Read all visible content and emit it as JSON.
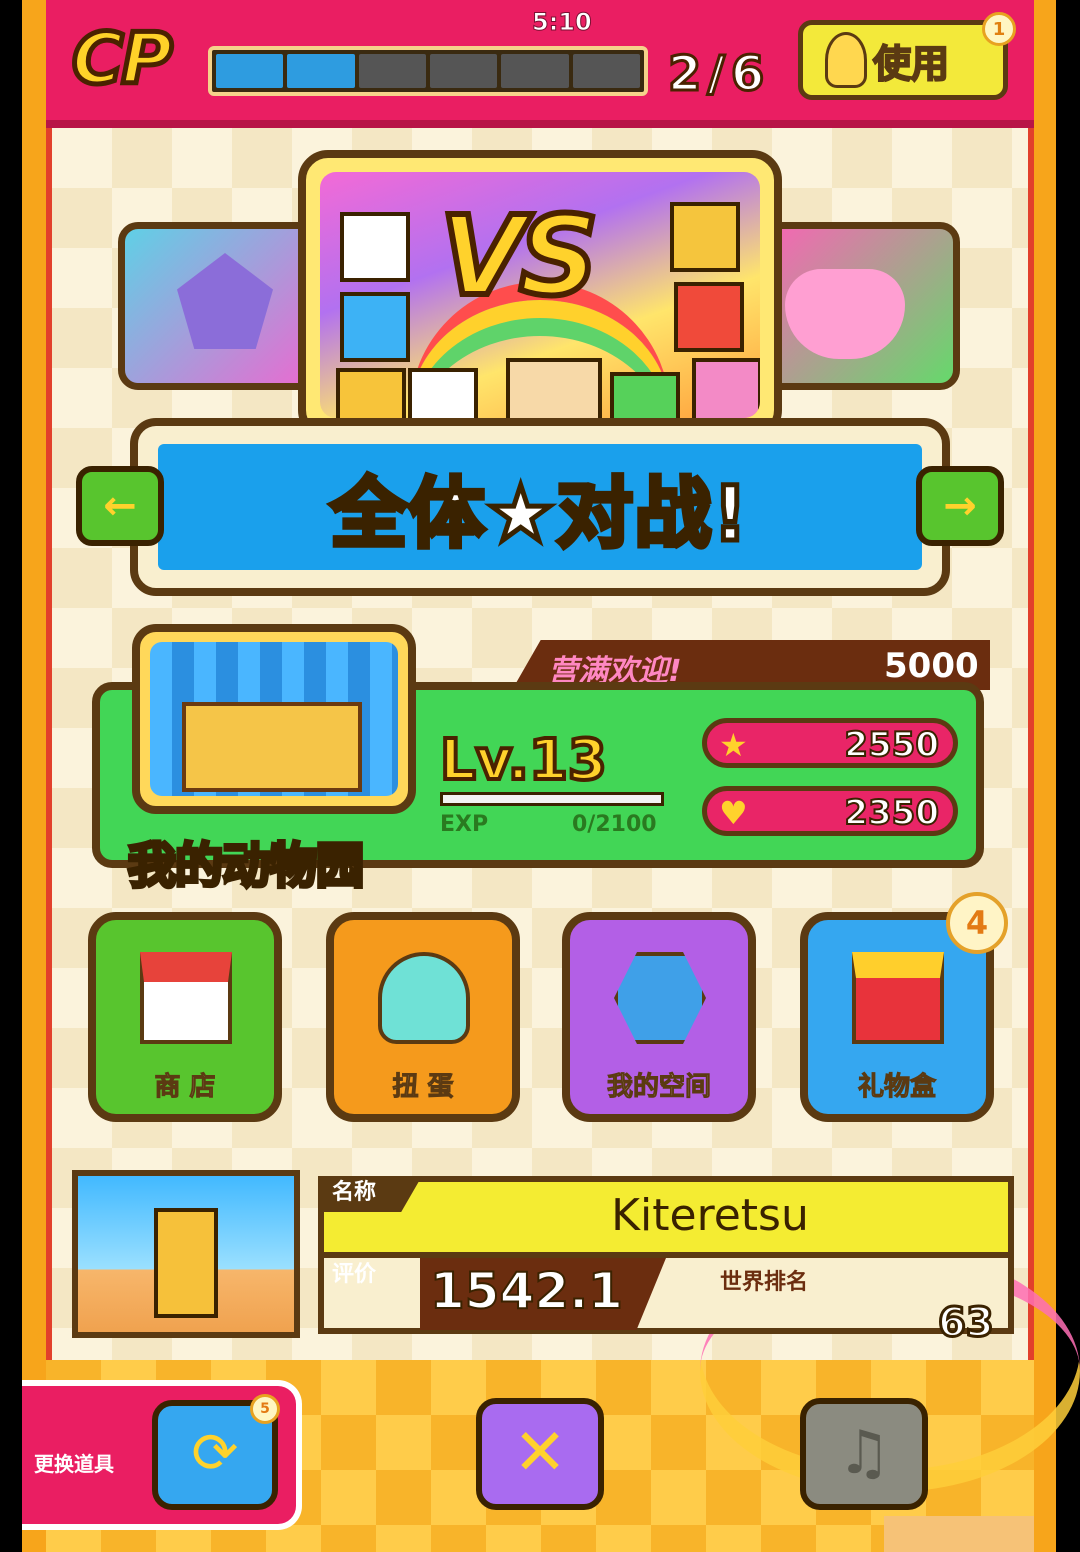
{
  "cp": {
    "label": "CP",
    "timer": "5:10",
    "current": 2,
    "max": 6,
    "count_text": "2/6",
    "use_button": "使用",
    "use_badge": "1"
  },
  "mode": {
    "title": "全体★对战!",
    "main_card": "VS",
    "left_arrow": "←",
    "right_arrow": "→"
  },
  "zoo": {
    "name": "我的动物园",
    "bonus_text": "营满欢迎!",
    "bonus_value": "5000",
    "level": "Lv.13",
    "exp_label": "EXP",
    "exp_value": "0/2100",
    "star_value": "2550",
    "heart_value": "2350"
  },
  "menu": [
    {
      "label": "商 店",
      "color": "#58c52e",
      "icon": "shop-icon"
    },
    {
      "label": "扭 蛋",
      "color": "#f59a1c",
      "icon": "gacha-icon"
    },
    {
      "label": "我的空间",
      "color": "#b35fe6",
      "icon": "room-icon"
    },
    {
      "label": "礼物盒",
      "color": "#35a7f0",
      "icon": "gift-icon"
    }
  ],
  "gift_badge": "4",
  "player": {
    "name_label": "名称",
    "name": "Kiteretsu",
    "rating_label": "评价",
    "rating": "1542.1",
    "rank_label": "世界排名",
    "rank": "63"
  },
  "bottom": {
    "swap_label": "更换道具",
    "swap_badge": "5",
    "close": "✕",
    "music": "♫"
  }
}
